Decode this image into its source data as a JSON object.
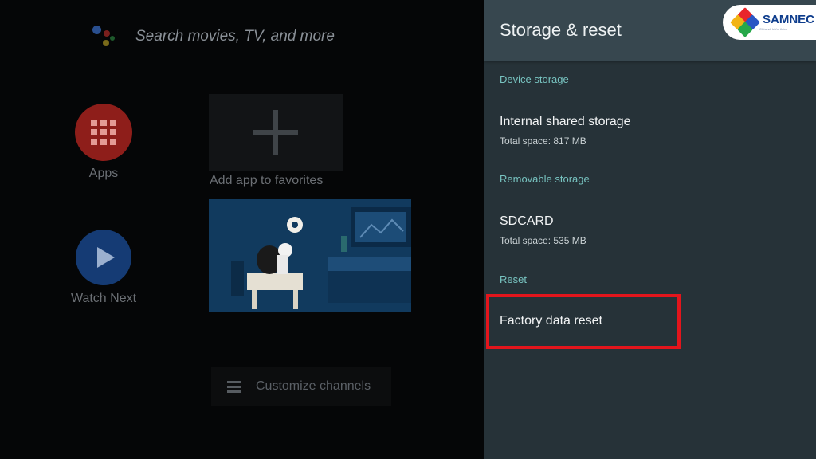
{
  "background": {
    "search_placeholder": "Search movies, TV, and more",
    "apps_label": "Apps",
    "watch_next_label": "Watch Next",
    "add_app_label": "Add app to favorites",
    "customize_channels_label": "Customize channels"
  },
  "panel": {
    "title": "Storage & reset",
    "sections": {
      "device_storage": "Device storage",
      "removable_storage": "Removable storage",
      "reset": "Reset"
    },
    "items": {
      "internal": {
        "title": "Internal shared storage",
        "subtitle": "Total space: 817 MB"
      },
      "sdcard": {
        "title": "SDCARD",
        "subtitle": "Total space: 535 MB"
      },
      "factory_reset": {
        "title": "Factory data reset"
      }
    }
  },
  "watermark": {
    "brand": "SAMNEC",
    "tagline": "Chia sẻ kiến thức"
  },
  "colors": {
    "panel_bg": "#263238",
    "panel_header_bg": "#37474f",
    "section_accent": "#78c4c1",
    "highlight_red": "#e3151c"
  }
}
